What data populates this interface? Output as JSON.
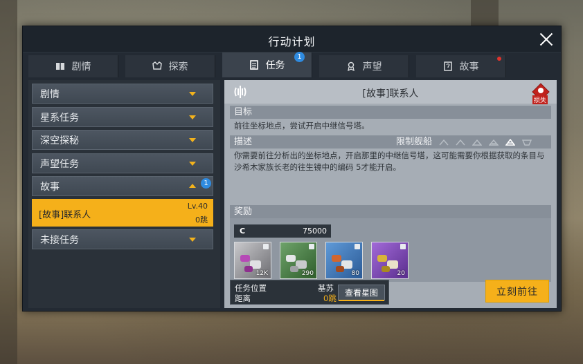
{
  "window": {
    "title": "行动计划"
  },
  "tabs": [
    {
      "label": "剧情",
      "icon": "book-icon"
    },
    {
      "label": "探索",
      "icon": "explore-icon"
    },
    {
      "label": "任务",
      "icon": "clipboard-icon",
      "active": true,
      "badge": "1"
    },
    {
      "label": "声望",
      "icon": "emblem-icon"
    },
    {
      "label": "故事",
      "icon": "story-icon",
      "dot": true
    }
  ],
  "sidebar": {
    "items": [
      {
        "label": "剧情"
      },
      {
        "label": "星系任务"
      },
      {
        "label": "深空探秘"
      },
      {
        "label": "声望任务"
      },
      {
        "label": "故事",
        "badge": "1",
        "expanded": true
      },
      {
        "label": "未接任务"
      }
    ],
    "selected": {
      "label": "[故事]联系人",
      "level": "Lv.40",
      "distance": "0跳"
    }
  },
  "detail": {
    "title": "[故事]联系人",
    "lost_label": "损失",
    "objective_header": "目标",
    "objective_text": "前往坐标地点，尝试开启中继信号塔。",
    "desc_header": "描述",
    "hull_limit_label": "限制舰船",
    "desc_text": "你需要前往分析出的坐标地点，开启那里的中继信号塔，这可能需要你根据获取的条目与沙希木家族长老的往生镜中的编码 5才能开启。",
    "rewards_header": "奖励",
    "credit_symbol": "C",
    "credit_amount": "75000",
    "rewards": [
      {
        "qty": "12K",
        "color": "#b64ab6"
      },
      {
        "qty": "290",
        "color": "#4f9b4c"
      },
      {
        "qty": "80",
        "color": "#d1662f"
      },
      {
        "qty": "20",
        "color": "#8a4cc9"
      }
    ],
    "location_label": "任务位置",
    "location_value": "基苏",
    "distance_label": "距离",
    "distance_value": "0跳",
    "view_map_label": "查看星图",
    "go_label": "立刻前往"
  },
  "colors": {
    "accent": "#f5b01a",
    "badge": "#2f8be0",
    "alert": "#e0332c"
  }
}
